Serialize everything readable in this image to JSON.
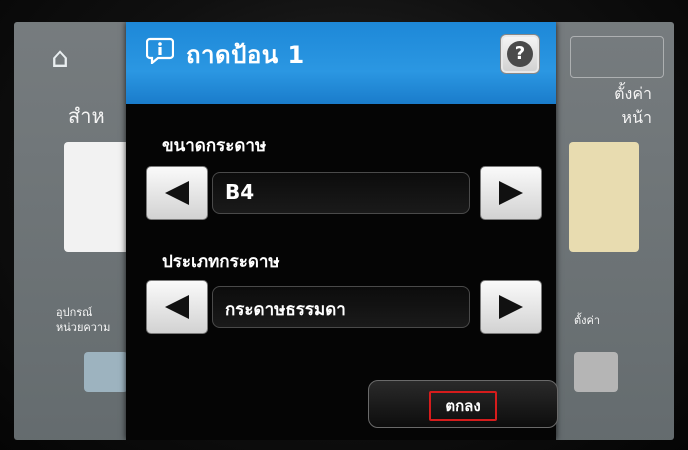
{
  "dialog": {
    "title": "ถาดป้อน 1",
    "help_icon": "help-icon",
    "info_icon": "info-icon",
    "paper_size": {
      "label": "ขนาดกระดาษ",
      "value": "B4"
    },
    "paper_type": {
      "label": "ประเภทกระดาษ",
      "value": "กระดาษธรรมดา"
    },
    "ok_label": "ตกลง"
  },
  "background": {
    "home_icon": "home-icon",
    "left_title": "สำห",
    "right_title_1": "ตั้งค่า",
    "right_title_2": "หน้า",
    "left_small_1": "อุปกรณ์",
    "left_small_2": "หน่วยความ",
    "right_small": "ตั้งค่า"
  },
  "colors": {
    "header_blue": "#2b97e2",
    "highlight_red": "#d61c1c"
  }
}
